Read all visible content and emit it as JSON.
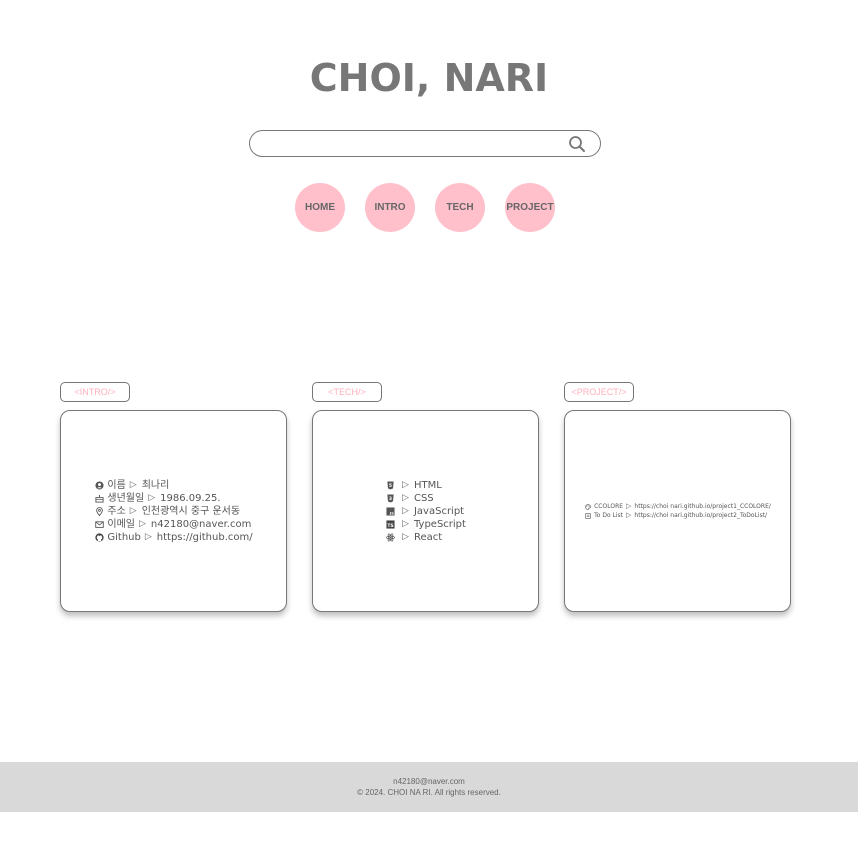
{
  "header": {
    "title": "CHOI, NARI"
  },
  "search": {
    "value": "",
    "placeholder": "",
    "icon": "search-icon"
  },
  "nav": [
    {
      "label": "HOME"
    },
    {
      "label": "INTRO"
    },
    {
      "label": "TECH"
    },
    {
      "label": "PROJECT"
    }
  ],
  "colors": {
    "accent": "#ffc0cb",
    "tag_text": "#ffb0bd",
    "footer_bg": "#d9d9d9",
    "title": "#777777"
  },
  "sections": {
    "intro": {
      "tag": "<INTRO/>",
      "items": [
        {
          "icon": "user-icon",
          "label": "이름",
          "value": "최나리"
        },
        {
          "icon": "cake-icon",
          "label": "생년월일",
          "value": "1986.09.25."
        },
        {
          "icon": "location-pin-icon",
          "label": "주소",
          "value": "인천광역시 중구 운서동"
        },
        {
          "icon": "mail-icon",
          "label": "이메일",
          "value": "n42180@naver.com"
        },
        {
          "icon": "github-icon",
          "label": "Github",
          "value": "https://github.com/"
        }
      ]
    },
    "tech": {
      "tag": "<TECH/>",
      "items": [
        {
          "icon": "html5-icon",
          "value": "HTML"
        },
        {
          "icon": "css3-icon",
          "value": "CSS"
        },
        {
          "icon": "javascript-icon",
          "value": "JavaScript"
        },
        {
          "icon": "typescript-icon",
          "value": "TypeScript"
        },
        {
          "icon": "react-icon",
          "value": "React"
        }
      ]
    },
    "project": {
      "tag": "<PROJECT/>",
      "items": [
        {
          "icon": "palette-icon",
          "label": "CCOLORE",
          "value": "https://choi nari.github.io/project1_CCOLORE/"
        },
        {
          "icon": "checklist-icon",
          "label": "To Do List",
          "value": "https://choi nari.github.io/project2_ToDoList/"
        }
      ]
    }
  },
  "arrow": "▷",
  "footer": {
    "email": "n42180@naver.com",
    "copyright": "© 2024. CHOI NA RI. All rights reserved."
  }
}
